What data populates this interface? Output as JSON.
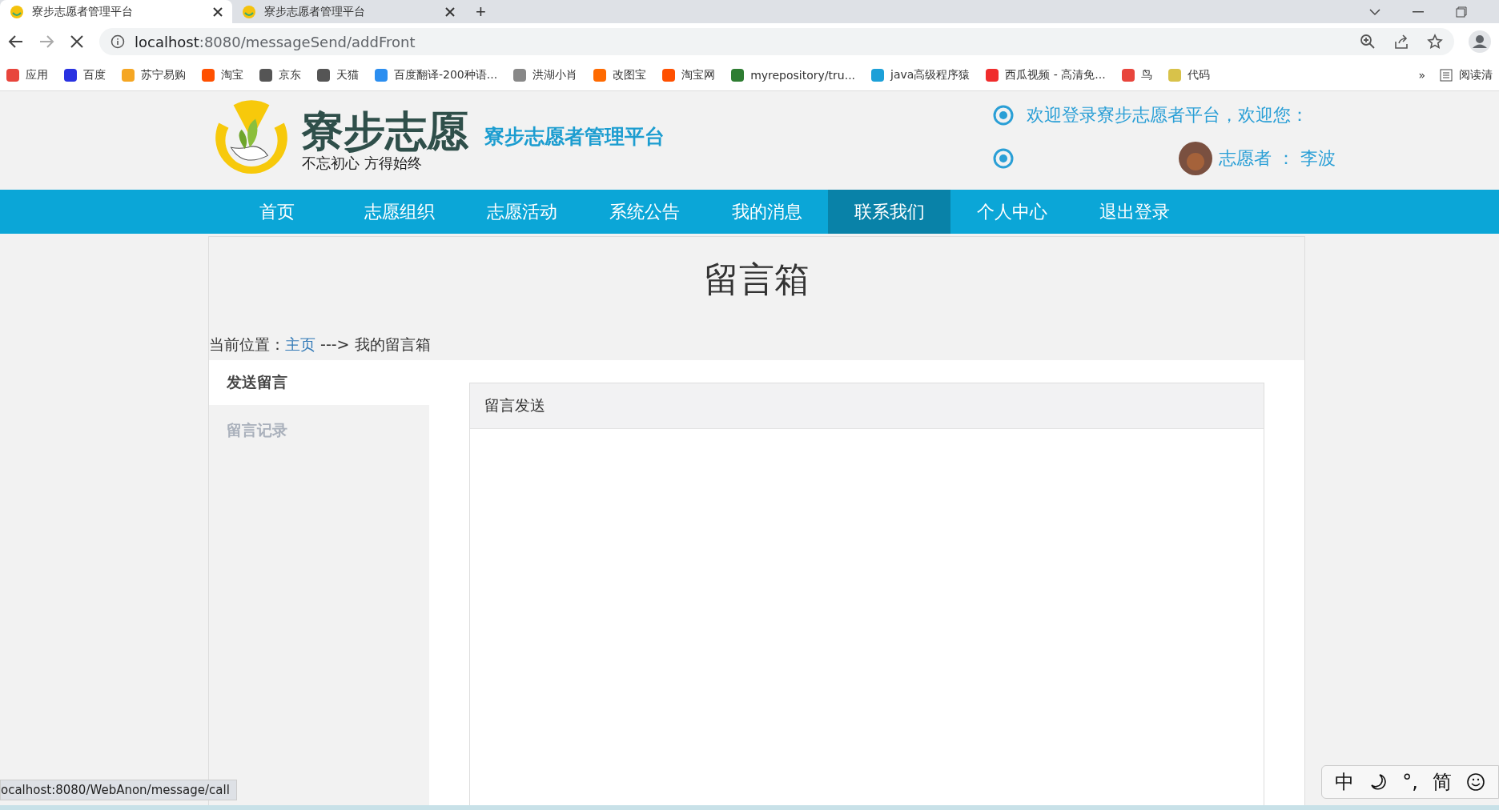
{
  "browser": {
    "tabs": [
      {
        "title": "寮步志愿者管理平台",
        "selected": true
      },
      {
        "title": "寮步志愿者管理平台",
        "selected": false
      }
    ],
    "new_tab": "+",
    "address": {
      "host": "localhost",
      "rest": ":8080/messageSend/addFront"
    },
    "bookmarks": [
      {
        "label": "应用",
        "color": "#e8453c"
      },
      {
        "label": "百度",
        "color": "#2932e1"
      },
      {
        "label": "苏宁易购",
        "color": "#f5a623"
      },
      {
        "label": "淘宝",
        "color": "#ff5000"
      },
      {
        "label": "京东",
        "color": "#555555"
      },
      {
        "label": "天猫",
        "color": "#555555"
      },
      {
        "label": "百度翻译-200种语...",
        "color": "#2b8ef0"
      },
      {
        "label": "洪湖小肖",
        "color": "#888888"
      },
      {
        "label": "改图宝",
        "color": "#ff6a00"
      },
      {
        "label": "淘宝网",
        "color": "#ff5000"
      },
      {
        "label": "myrepository/tru...",
        "color": "#2e7d32"
      },
      {
        "label": "java高级程序猿",
        "color": "#1ca0d8"
      },
      {
        "label": "西瓜视频 - 高清免...",
        "color": "#f02c2c"
      },
      {
        "label": "鸟",
        "color": "#e8453c"
      },
      {
        "label": "代码",
        "color": "#d8c24a"
      }
    ],
    "more": "»",
    "reading_list": "阅读清"
  },
  "header": {
    "logo_title": "寮步志愿",
    "slogan": "不忘初心  方得始终",
    "subtitle": "寮步志愿者管理平台",
    "welcome": "欢迎登录寮步志愿者平台，欢迎您：",
    "user": "志愿者 ：  李波"
  },
  "nav": [
    {
      "label": "首页",
      "selected": false
    },
    {
      "label": "志愿组织",
      "selected": false
    },
    {
      "label": "志愿活动",
      "selected": false
    },
    {
      "label": "系统公告",
      "selected": false
    },
    {
      "label": "我的消息",
      "selected": false
    },
    {
      "label": "联系我们",
      "selected": true
    },
    {
      "label": "个人中心",
      "selected": false
    },
    {
      "label": "退出登录",
      "selected": false
    }
  ],
  "page_title": "留言箱",
  "breadcrumb": {
    "label": "当前位置：",
    "home": "主页",
    "separator": "--->",
    "current": "我的留言箱"
  },
  "sidebar": [
    {
      "label": "发送留言",
      "selected": true
    },
    {
      "label": "留言记录",
      "selected": false
    }
  ],
  "panel": {
    "title": "留言发送"
  },
  "status_bar": "ocalhost:8080/WebAnon/message/call",
  "ime": [
    "中",
    "°,",
    "简"
  ]
}
